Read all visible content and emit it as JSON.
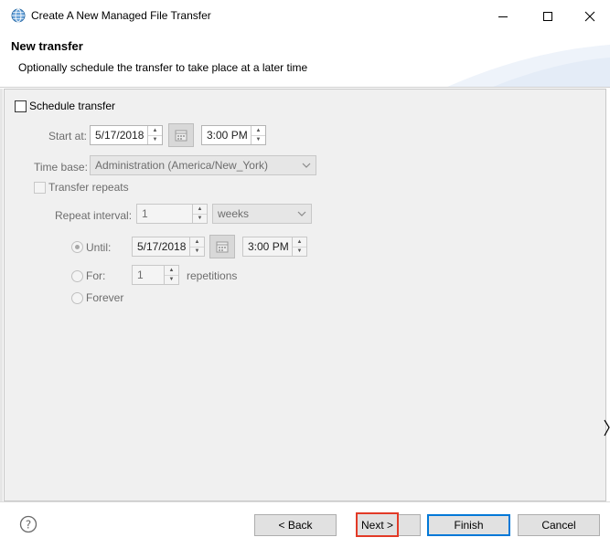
{
  "window": {
    "title": "Create A New Managed File Transfer",
    "icon": "globe-icon",
    "controls": [
      "minimize-icon",
      "maximize-icon",
      "close-icon"
    ]
  },
  "header": {
    "title": "New transfer",
    "description": "Optionally schedule the transfer to take place at a later time"
  },
  "schedule": {
    "checkbox_label": "Schedule transfer",
    "checked": false,
    "start_label": "Start at:",
    "start_date": "5/17/2018",
    "start_time": "3:00 PM",
    "time_base_label": "Time base:",
    "time_base_value": "Administration (America/New_York)",
    "repeats_label": "Transfer repeats",
    "repeat_interval_label": "Repeat interval:",
    "repeat_interval_value": "1",
    "repeat_unit": "weeks",
    "until_label": "Until:",
    "until_date": "5/17/2018",
    "until_time": "3:00 PM",
    "for_label": "For:",
    "for_value": "1",
    "repetitions_label": "repetitions",
    "forever_label": "Forever"
  },
  "footer": {
    "back_label": "< Back",
    "next_label": "Next >",
    "finish_label": "Finish",
    "cancel_label": "Cancel",
    "help_icon": "help-icon"
  },
  "colors": {
    "highlight": "#e23a27",
    "default_button_border": "#0078d7",
    "content_background": "#f0f0f0"
  }
}
